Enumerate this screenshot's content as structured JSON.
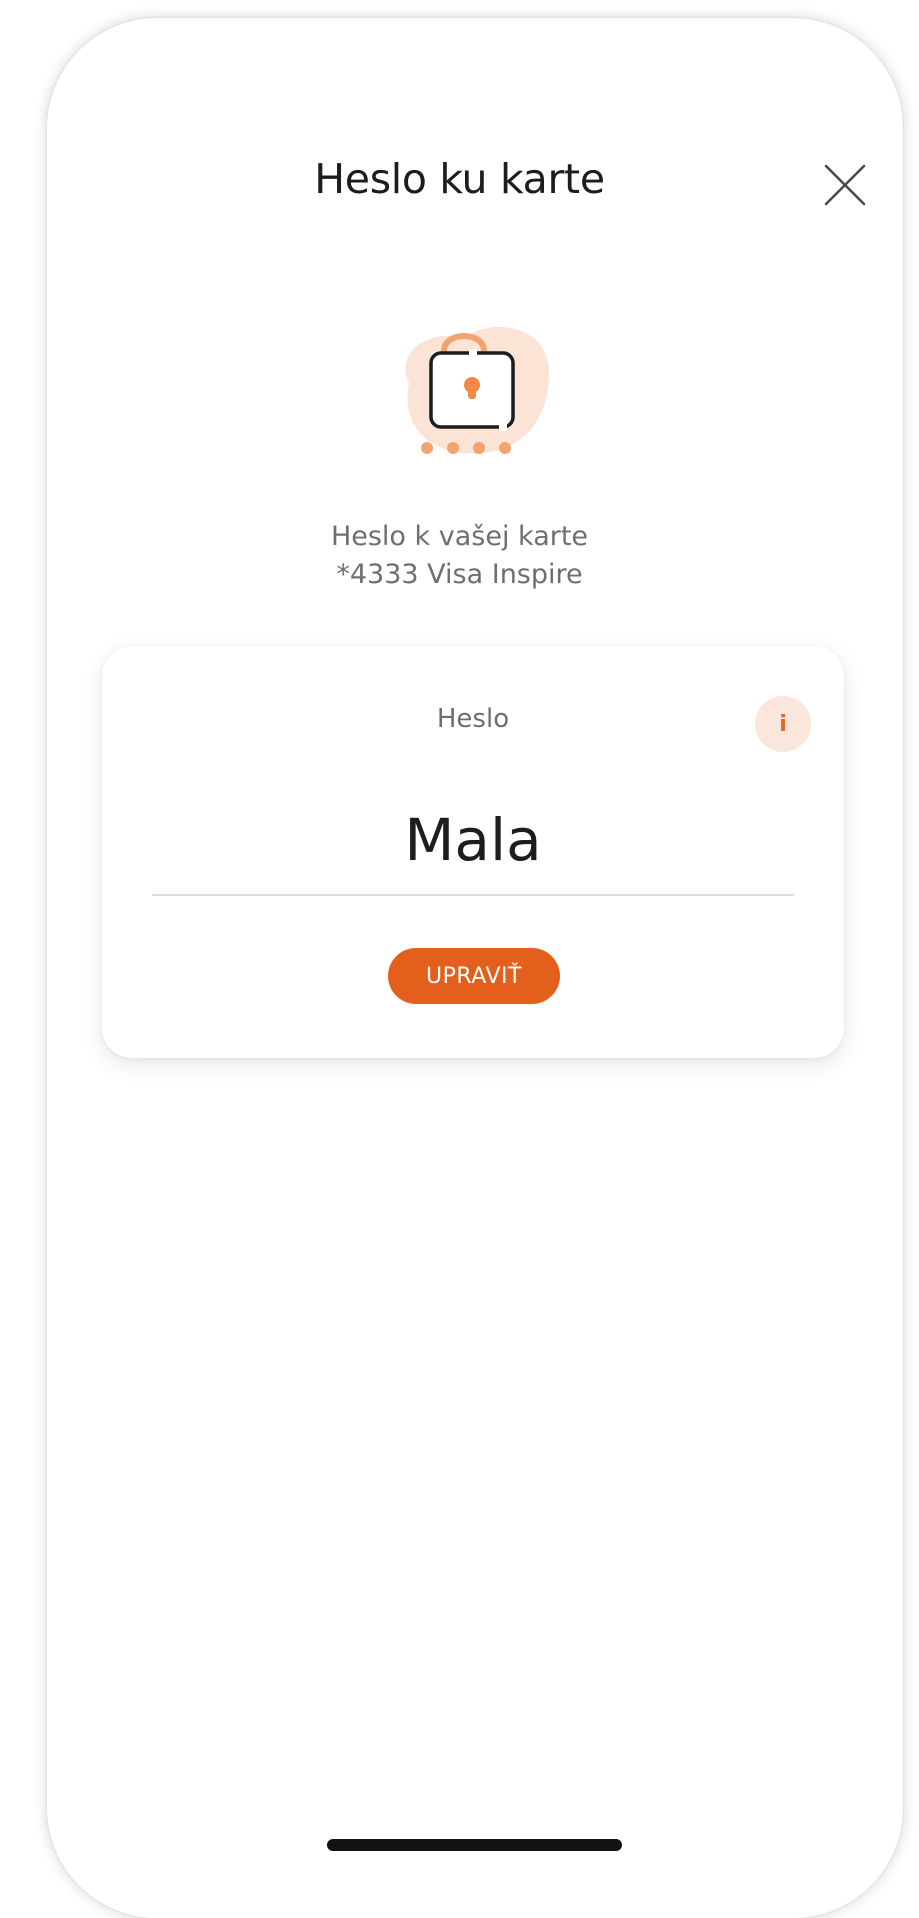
{
  "header": {
    "title": "Heslo ku karte"
  },
  "icons": {
    "close": "close-icon",
    "lock": "lock-icon",
    "info": "info-icon"
  },
  "subtitle": {
    "line1": "Heslo k vašej karte",
    "line2": "*4333 Visa Inspire"
  },
  "card": {
    "label": "Heslo",
    "info_glyph": "i",
    "value": "Mala",
    "edit_label": "UPRAVIŤ"
  },
  "colors": {
    "accent": "#e45f1c",
    "accent_light": "#fbe6dc",
    "illustration_blob": "#fbe3d5",
    "text_primary": "#1d1d1d",
    "text_secondary": "#6f6f6f"
  }
}
